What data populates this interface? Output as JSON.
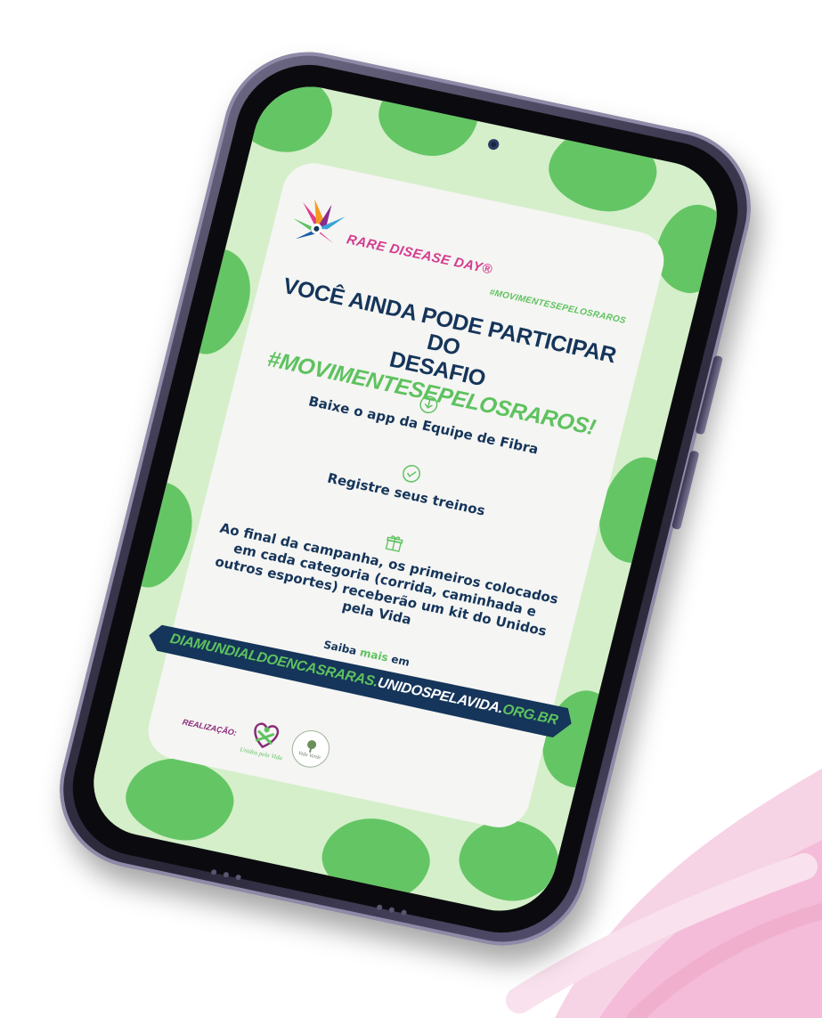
{
  "brand": {
    "logo_text": "RARE DISEASE DAY®"
  },
  "hashtag_top": "#MOVIMENTESEPELOSRAROS",
  "headline": {
    "line1": "VOCÊ AINDA PODE PARTICIPAR DO",
    "line2_prefix": "DESAFIO ",
    "line2_accent": "#MOVIMENTESEPELOSRAROS!"
  },
  "steps": [
    {
      "icon": "download-icon",
      "text": "Baixe o app da Equipe de Fibra"
    },
    {
      "icon": "check-circle-icon",
      "text": "Registre seus treinos"
    },
    {
      "icon": "gift-icon",
      "text": "Ao final da campanha, os primeiros colocados em cada categoria (corrida, caminhada e outros esportes) receberão um kit do Unidos pela Vida"
    }
  ],
  "saiba": {
    "prefix": "Saiba ",
    "highlight": "mais",
    "suffix": " em"
  },
  "url": {
    "part1": "DIAMUNDIALDOENCASRARAS.",
    "part2": "UNIDOSPELAVIDA.",
    "part3": "ORG.BR"
  },
  "footer": {
    "label": "REALIZAÇÃO:",
    "partner1_name": "Unidos pela Vida",
    "partner2_name": "Vida Verde"
  },
  "colors": {
    "navy": "#15355a",
    "green": "#5ec25f",
    "light_green": "#d4efc9",
    "pink": "#d43b8f",
    "purple": "#8a2a7a"
  }
}
